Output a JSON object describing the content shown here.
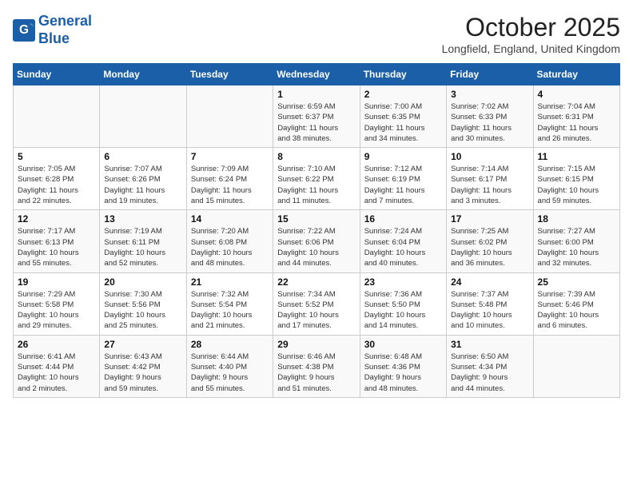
{
  "header": {
    "logo_line1": "General",
    "logo_line2": "Blue",
    "month": "October 2025",
    "location": "Longfield, England, United Kingdom"
  },
  "weekdays": [
    "Sunday",
    "Monday",
    "Tuesday",
    "Wednesday",
    "Thursday",
    "Friday",
    "Saturday"
  ],
  "weeks": [
    [
      {
        "day": "",
        "info": ""
      },
      {
        "day": "",
        "info": ""
      },
      {
        "day": "",
        "info": ""
      },
      {
        "day": "1",
        "info": "Sunrise: 6:59 AM\nSunset: 6:37 PM\nDaylight: 11 hours\nand 38 minutes."
      },
      {
        "day": "2",
        "info": "Sunrise: 7:00 AM\nSunset: 6:35 PM\nDaylight: 11 hours\nand 34 minutes."
      },
      {
        "day": "3",
        "info": "Sunrise: 7:02 AM\nSunset: 6:33 PM\nDaylight: 11 hours\nand 30 minutes."
      },
      {
        "day": "4",
        "info": "Sunrise: 7:04 AM\nSunset: 6:31 PM\nDaylight: 11 hours\nand 26 minutes."
      }
    ],
    [
      {
        "day": "5",
        "info": "Sunrise: 7:05 AM\nSunset: 6:28 PM\nDaylight: 11 hours\nand 22 minutes."
      },
      {
        "day": "6",
        "info": "Sunrise: 7:07 AM\nSunset: 6:26 PM\nDaylight: 11 hours\nand 19 minutes."
      },
      {
        "day": "7",
        "info": "Sunrise: 7:09 AM\nSunset: 6:24 PM\nDaylight: 11 hours\nand 15 minutes."
      },
      {
        "day": "8",
        "info": "Sunrise: 7:10 AM\nSunset: 6:22 PM\nDaylight: 11 hours\nand 11 minutes."
      },
      {
        "day": "9",
        "info": "Sunrise: 7:12 AM\nSunset: 6:19 PM\nDaylight: 11 hours\nand 7 minutes."
      },
      {
        "day": "10",
        "info": "Sunrise: 7:14 AM\nSunset: 6:17 PM\nDaylight: 11 hours\nand 3 minutes."
      },
      {
        "day": "11",
        "info": "Sunrise: 7:15 AM\nSunset: 6:15 PM\nDaylight: 10 hours\nand 59 minutes."
      }
    ],
    [
      {
        "day": "12",
        "info": "Sunrise: 7:17 AM\nSunset: 6:13 PM\nDaylight: 10 hours\nand 55 minutes."
      },
      {
        "day": "13",
        "info": "Sunrise: 7:19 AM\nSunset: 6:11 PM\nDaylight: 10 hours\nand 52 minutes."
      },
      {
        "day": "14",
        "info": "Sunrise: 7:20 AM\nSunset: 6:08 PM\nDaylight: 10 hours\nand 48 minutes."
      },
      {
        "day": "15",
        "info": "Sunrise: 7:22 AM\nSunset: 6:06 PM\nDaylight: 10 hours\nand 44 minutes."
      },
      {
        "day": "16",
        "info": "Sunrise: 7:24 AM\nSunset: 6:04 PM\nDaylight: 10 hours\nand 40 minutes."
      },
      {
        "day": "17",
        "info": "Sunrise: 7:25 AM\nSunset: 6:02 PM\nDaylight: 10 hours\nand 36 minutes."
      },
      {
        "day": "18",
        "info": "Sunrise: 7:27 AM\nSunset: 6:00 PM\nDaylight: 10 hours\nand 32 minutes."
      }
    ],
    [
      {
        "day": "19",
        "info": "Sunrise: 7:29 AM\nSunset: 5:58 PM\nDaylight: 10 hours\nand 29 minutes."
      },
      {
        "day": "20",
        "info": "Sunrise: 7:30 AM\nSunset: 5:56 PM\nDaylight: 10 hours\nand 25 minutes."
      },
      {
        "day": "21",
        "info": "Sunrise: 7:32 AM\nSunset: 5:54 PM\nDaylight: 10 hours\nand 21 minutes."
      },
      {
        "day": "22",
        "info": "Sunrise: 7:34 AM\nSunset: 5:52 PM\nDaylight: 10 hours\nand 17 minutes."
      },
      {
        "day": "23",
        "info": "Sunrise: 7:36 AM\nSunset: 5:50 PM\nDaylight: 10 hours\nand 14 minutes."
      },
      {
        "day": "24",
        "info": "Sunrise: 7:37 AM\nSunset: 5:48 PM\nDaylight: 10 hours\nand 10 minutes."
      },
      {
        "day": "25",
        "info": "Sunrise: 7:39 AM\nSunset: 5:46 PM\nDaylight: 10 hours\nand 6 minutes."
      }
    ],
    [
      {
        "day": "26",
        "info": "Sunrise: 6:41 AM\nSunset: 4:44 PM\nDaylight: 10 hours\nand 2 minutes."
      },
      {
        "day": "27",
        "info": "Sunrise: 6:43 AM\nSunset: 4:42 PM\nDaylight: 9 hours\nand 59 minutes."
      },
      {
        "day": "28",
        "info": "Sunrise: 6:44 AM\nSunset: 4:40 PM\nDaylight: 9 hours\nand 55 minutes."
      },
      {
        "day": "29",
        "info": "Sunrise: 6:46 AM\nSunset: 4:38 PM\nDaylight: 9 hours\nand 51 minutes."
      },
      {
        "day": "30",
        "info": "Sunrise: 6:48 AM\nSunset: 4:36 PM\nDaylight: 9 hours\nand 48 minutes."
      },
      {
        "day": "31",
        "info": "Sunrise: 6:50 AM\nSunset: 4:34 PM\nDaylight: 9 hours\nand 44 minutes."
      },
      {
        "day": "",
        "info": ""
      }
    ]
  ]
}
